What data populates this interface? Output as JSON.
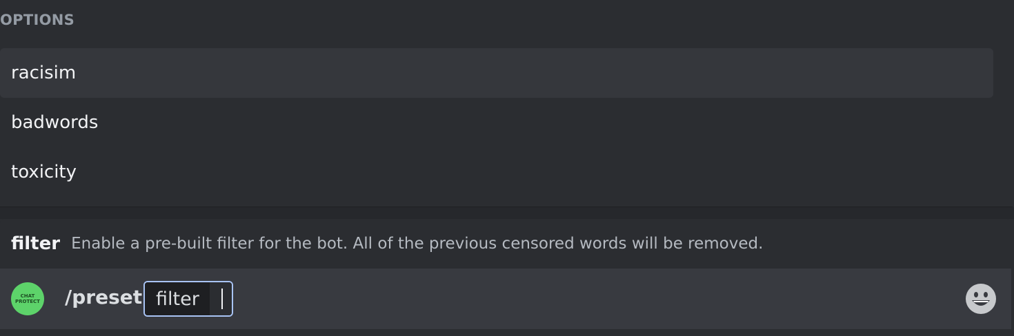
{
  "options_panel": {
    "header": "OPTIONS",
    "items": [
      {
        "label": "racisim",
        "selected": true
      },
      {
        "label": "badwords",
        "selected": false
      },
      {
        "label": "toxicity",
        "selected": false
      }
    ]
  },
  "command_description": {
    "name": "filter",
    "text": "Enable a pre-built filter for the bot. All of the previous censored words will be removed."
  },
  "input_bar": {
    "avatar_text_line1": "CHAT",
    "avatar_text_line2": "PROTECT",
    "command": "/preset",
    "option_name": "filter",
    "option_value": "",
    "emoji_icon": "smiley-face-icon"
  },
  "colors": {
    "background": "#2b2d31",
    "selected_option": "#35373c",
    "input_bar": "#383a40",
    "chip_border": "#a9c4f5",
    "avatar": "#5dd36a"
  }
}
